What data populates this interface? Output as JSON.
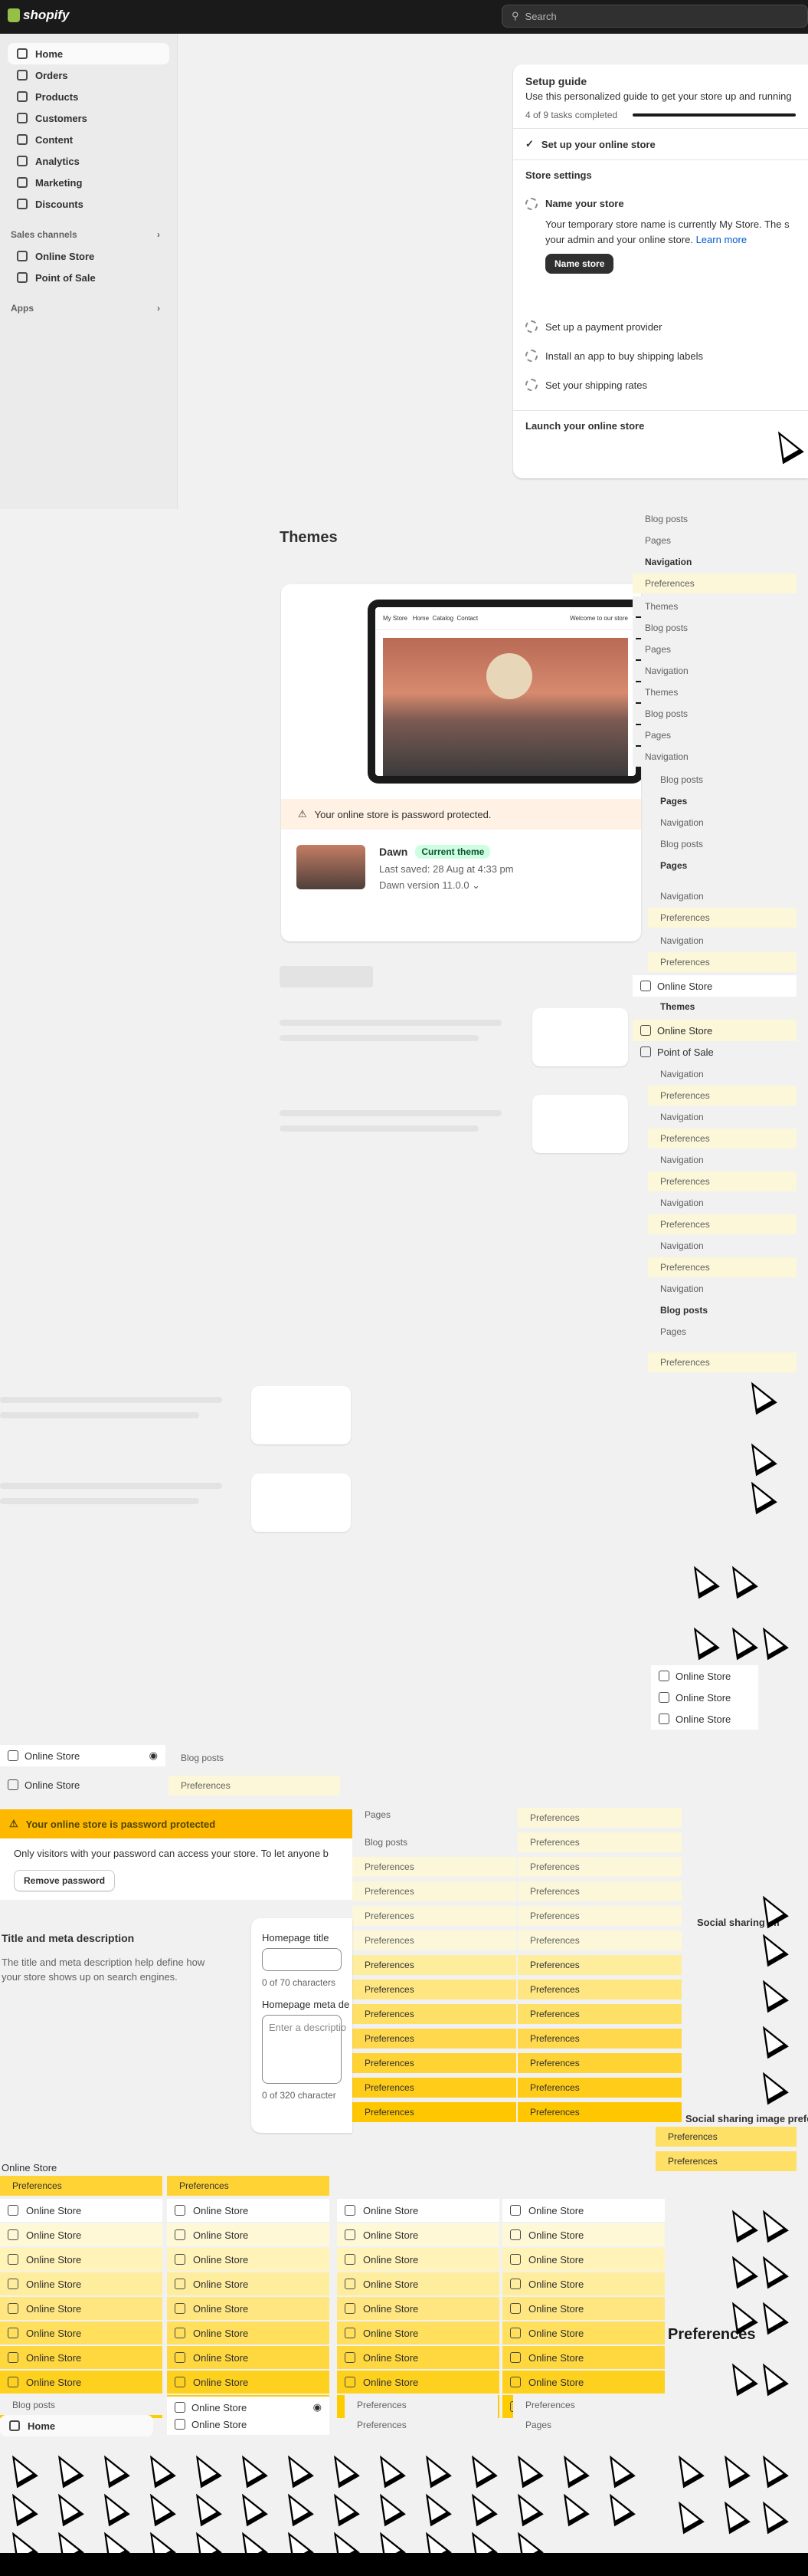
{
  "topbar": {
    "logo_text": "shopify",
    "search_placeholder": "Search"
  },
  "sidebar": {
    "items": [
      {
        "label": "Home",
        "icon": "home-icon",
        "active": true
      },
      {
        "label": "Orders",
        "icon": "orders-icon"
      },
      {
        "label": "Products",
        "icon": "tag-icon"
      },
      {
        "label": "Customers",
        "icon": "person-icon"
      },
      {
        "label": "Content",
        "icon": "content-icon"
      },
      {
        "label": "Analytics",
        "icon": "chart-icon"
      },
      {
        "label": "Marketing",
        "icon": "target-icon"
      },
      {
        "label": "Discounts",
        "icon": "discount-icon"
      }
    ],
    "sales_channels_label": "Sales channels",
    "channels": [
      {
        "label": "Online Store",
        "icon": "store-icon"
      },
      {
        "label": "Point of Sale",
        "icon": "pos-icon"
      }
    ],
    "apps_label": "Apps"
  },
  "setup": {
    "title": "Setup guide",
    "desc": "Use this personalized guide to get your store up and running",
    "progress": "4 of 9 tasks completed",
    "section_done": "Set up your online store",
    "section_store_settings": "Store settings",
    "task_name": "Name your store",
    "task_name_text_1": "Your temporary store name is currently My Store. The s",
    "task_name_text_2": "your admin and your online store.",
    "learn_more": "Learn more",
    "name_button": "Name store",
    "tasks": [
      "Set up a payment provider",
      "Install an app to buy shipping labels",
      "Set your shipping rates"
    ],
    "launch": "Launch your online store"
  },
  "themes": {
    "title": "Themes",
    "preview_store": "My Store",
    "preview_nav": [
      "Home",
      "Catalog",
      "Contact"
    ],
    "preview_welcome": "Welcome to our store",
    "password_banner": "Your online store is password protected.",
    "theme_name": "Dawn",
    "current_badge": "Current theme",
    "last_saved": "Last saved: 28 Aug at 4:33 pm",
    "version": "Dawn version 11.0.0"
  },
  "menu": {
    "blog_posts": "Blog posts",
    "pages": "Pages",
    "navigation": "Navigation",
    "preferences": "Preferences",
    "themes": "Themes",
    "online_store": "Online Store",
    "point_of_sale": "Point of Sale",
    "home": "Home"
  },
  "password_section": {
    "banner": "Your online store is password protected",
    "body": "Only visitors with your password can access your store. To let anyone b",
    "button": "Remove password"
  },
  "meta": {
    "title": "Title and meta description",
    "desc": "The title and meta description help define how your store shows up on search engines.",
    "homepage_title_label": "Homepage title",
    "title_count": "0 of 70 characters",
    "meta_label": "Homepage meta de",
    "meta_placeholder": "Enter a descriptio",
    "meta_count": "0 of 320 character"
  },
  "social": {
    "label": "Social sharing im",
    "label2": "Social sharing image preference"
  }
}
